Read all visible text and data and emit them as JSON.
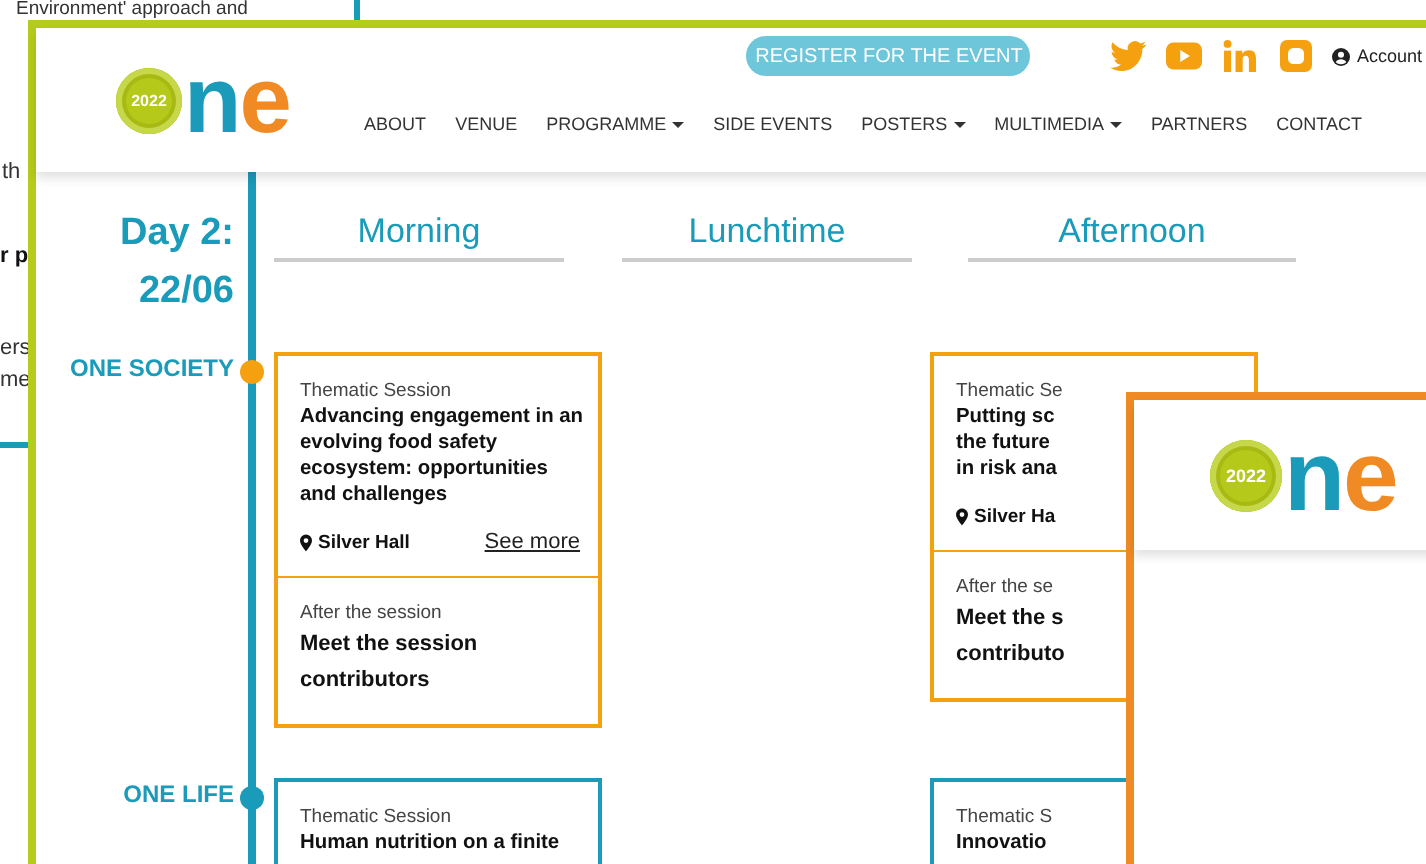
{
  "background_page": {
    "lines": [
      {
        "text": "Environment' approach and",
        "bold": false
      },
      {
        "text": "th",
        "bold": false
      },
      {
        "text": "r p",
        "bold": true
      },
      {
        "text": "ers",
        "bold": false
      },
      {
        "text": "me",
        "bold": false
      }
    ]
  },
  "main_window": {
    "logo": {
      "year": "2022",
      "wordmark": "ne"
    },
    "register_button": "REGISTER FOR THE EVENT",
    "account": "Account",
    "nav": [
      {
        "label": "ABOUT",
        "dropdown": false
      },
      {
        "label": "VENUE",
        "dropdown": false
      },
      {
        "label": "PROGRAMME",
        "dropdown": true
      },
      {
        "label": "SIDE EVENTS",
        "dropdown": false
      },
      {
        "label": "POSTERS",
        "dropdown": true
      },
      {
        "label": "MULTIMEDIA",
        "dropdown": true
      },
      {
        "label": "PARTNERS",
        "dropdown": false
      },
      {
        "label": "CONTACT",
        "dropdown": false
      }
    ],
    "day": {
      "title": "Day 2:",
      "date": "22/06"
    },
    "periods": [
      "Morning",
      "Lunchtime",
      "Afternoon"
    ],
    "tracks": [
      {
        "name": "ONE SOCIETY",
        "color": "#f5a00f",
        "morning": {
          "type": "Thematic Session",
          "title": "Advancing engagement in an\nevolving food safety\necosystem: opportunities\nand challenges",
          "venue": "Silver Hall",
          "link": "See more",
          "after": {
            "label": "After the session",
            "title": "Meet the session\ncontributors"
          }
        },
        "afternoon": {
          "type": "Thematic Se",
          "title": "Putting sc\nthe future\nin risk ana",
          "venue": "Silver Ha",
          "after": {
            "label": "After the se",
            "title": "Meet the s\ncontributo"
          }
        }
      },
      {
        "name": "ONE LIFE",
        "color": "#1a9bb9",
        "morning": {
          "type": "Thematic Session",
          "title": "Human nutrition on a finite"
        },
        "afternoon": {
          "type": "Thematic S",
          "title": "Innovatio"
        }
      }
    ]
  },
  "second_window": {
    "logo": {
      "year": "2022",
      "wordmark": "ne"
    }
  }
}
